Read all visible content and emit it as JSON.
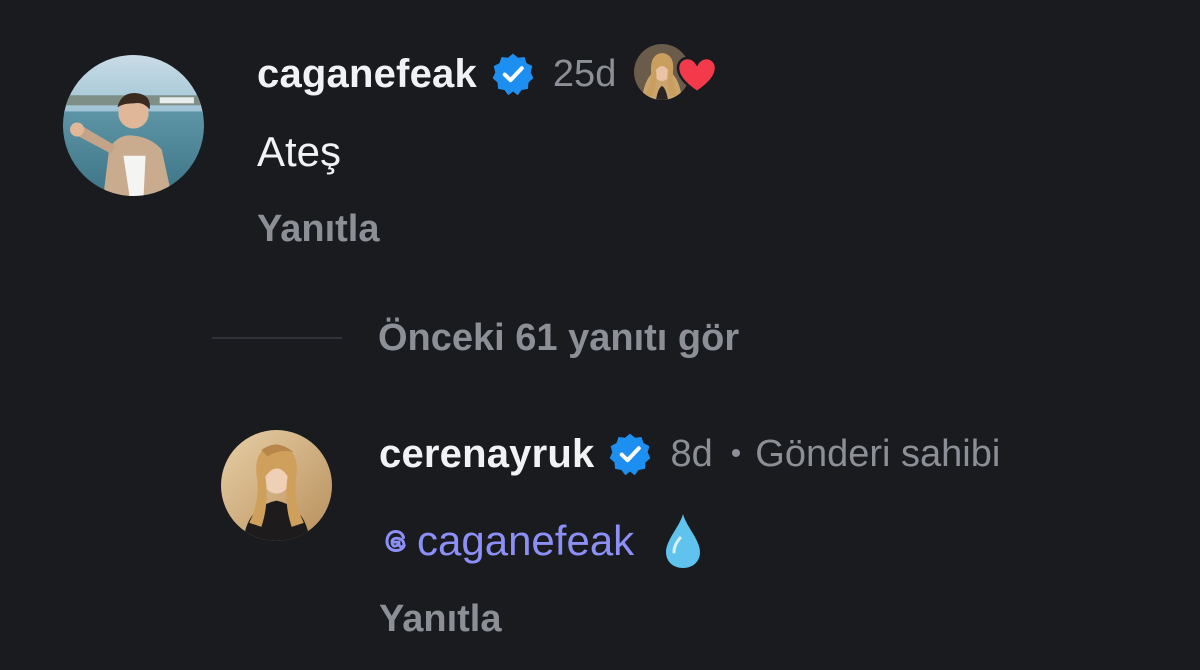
{
  "comment": {
    "username": "caganefeak",
    "timestamp": "25d",
    "text": "Ateş",
    "reply_label": "Yanıtla",
    "liked_by_author_icon": "heart-icon"
  },
  "replies_toggle": {
    "label": "Önceki 61 yanıtı gör"
  },
  "reply": {
    "username": "cerenayruk",
    "timestamp": "8d",
    "separator": "•",
    "owner_badge": "Gönderi sahibi",
    "mention": "caganefeak",
    "emoji": "💧",
    "reply_label": "Yanıtla"
  },
  "colors": {
    "background": "#191b1f",
    "primary_text": "#f1f2f4",
    "secondary_text": "#8c8f96",
    "mention": "#8b8ff6",
    "verified_badge": "#1d8ff0",
    "heart": "#f23a4b",
    "drop": "#5fc3ee"
  }
}
